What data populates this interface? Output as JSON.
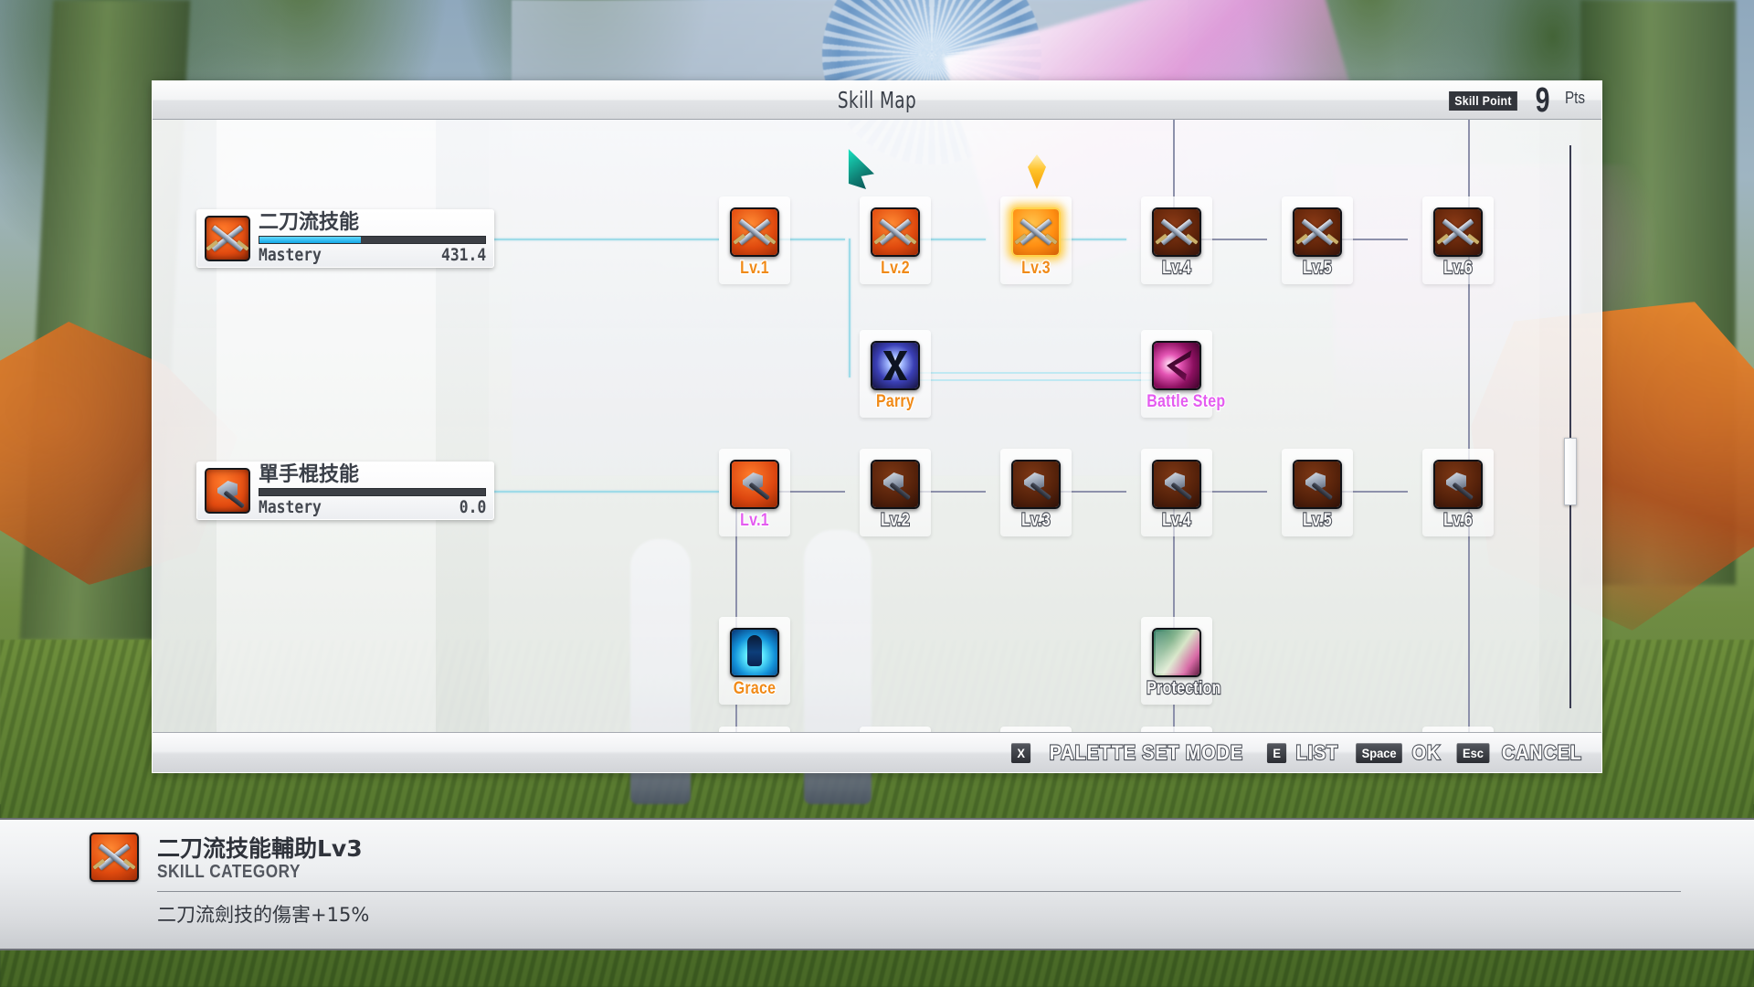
{
  "window": {
    "title": "Skill Map",
    "skill_point_label": "Skill Point",
    "skill_point_value": "9",
    "skill_point_unit": "Pts"
  },
  "categories": [
    {
      "name": "二刀流技能",
      "mastery_label": "Mastery",
      "mastery_value": "431.4",
      "mastery_percent": 45,
      "icon": "crossed-swords-icon"
    },
    {
      "name": "單手棍技能",
      "mastery_label": "Mastery",
      "mastery_value": "0.0",
      "mastery_percent": 0,
      "icon": "axe-icon"
    }
  ],
  "nodes": {
    "sword_row": [
      {
        "label": "Lv.1",
        "state": "unlocked",
        "icon": "crossed-swords-icon"
      },
      {
        "label": "Lv.2",
        "state": "unlocked",
        "icon": "crossed-swords-icon"
      },
      {
        "label": "Lv.3",
        "state": "selected",
        "icon": "crossed-swords-icon"
      },
      {
        "label": "Lv.4",
        "state": "locked",
        "icon": "crossed-swords-icon"
      },
      {
        "label": "Lv.5",
        "state": "locked",
        "icon": "crossed-swords-icon"
      },
      {
        "label": "Lv.6",
        "state": "locked",
        "icon": "crossed-swords-icon"
      }
    ],
    "sword_branch": [
      {
        "label": "Parry",
        "state": "unlocked",
        "icon": "parry-icon"
      },
      {
        "label": "Battle Step",
        "state": "purchasable",
        "icon": "battle-step-icon"
      }
    ],
    "axe_row": [
      {
        "label": "Lv.1",
        "state": "purchasable",
        "icon": "axe-icon"
      },
      {
        "label": "Lv.2",
        "state": "locked",
        "icon": "axe-icon"
      },
      {
        "label": "Lv.3",
        "state": "locked",
        "icon": "axe-icon"
      },
      {
        "label": "Lv.4",
        "state": "locked",
        "icon": "axe-icon"
      },
      {
        "label": "Lv.5",
        "state": "locked",
        "icon": "axe-icon"
      },
      {
        "label": "Lv.6",
        "state": "locked",
        "icon": "axe-icon"
      }
    ],
    "axe_branch": [
      {
        "label": "Grace",
        "state": "unlocked",
        "icon": "grace-icon"
      },
      {
        "label": "Protection",
        "state": "locked",
        "icon": "protection-icon"
      }
    ]
  },
  "footer_hints": [
    {
      "key": "X",
      "label": "PALETTE SET MODE"
    },
    {
      "key": "E",
      "label": "LIST"
    },
    {
      "key": "Space",
      "label": "OK"
    },
    {
      "key": "Esc",
      "label": "CANCEL"
    }
  ],
  "description": {
    "title": "二刀流技能輔助Lv3",
    "subtitle": "SKILL CATEGORY",
    "body": "二刀流劍技的傷害+15%"
  },
  "colors": {
    "accent_orange": "#f08a18",
    "accent_purple": "#e45cf0",
    "line_active": "#9fdbe8",
    "line_locked": "#8d91ab",
    "mastery_fill": "#13a7e6",
    "selection_gold": "#ffc229"
  }
}
